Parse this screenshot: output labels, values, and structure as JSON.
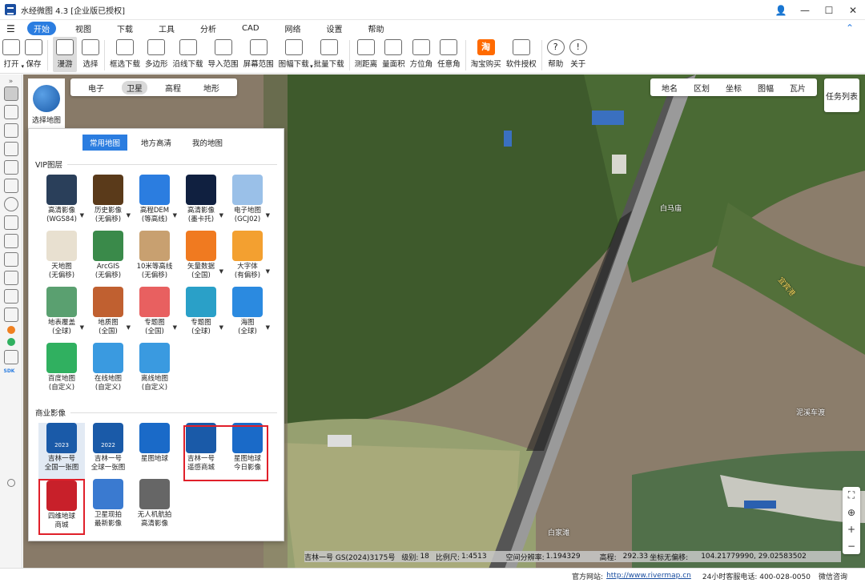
{
  "app": {
    "title": "水经微图 4.3 [企业版已授权]"
  },
  "window": {
    "user_icon": "user-icon",
    "minimize": "—",
    "maximize": "☐",
    "close": "✕"
  },
  "menu": {
    "items": [
      "开始",
      "视图",
      "下载",
      "工具",
      "分析",
      "CAD",
      "网络",
      "设置",
      "帮助"
    ],
    "active": "开始"
  },
  "toolbar": {
    "items": [
      {
        "label": "打开",
        "icon": "folder-icon",
        "dropdown": true
      },
      {
        "label": "保存",
        "icon": "save-icon"
      },
      {
        "label": "漫游",
        "icon": "hand-icon",
        "selected": true
      },
      {
        "label": "选择",
        "icon": "pointer-icon"
      },
      {
        "label": "框选下载",
        "icon": "box-select-download-icon"
      },
      {
        "label": "多边形",
        "icon": "polygon-icon"
      },
      {
        "label": "沿线下载",
        "icon": "line-download-icon"
      },
      {
        "label": "导入范围",
        "icon": "import-range-icon"
      },
      {
        "label": "屏幕范围",
        "icon": "screen-range-icon"
      },
      {
        "label": "图幅下载",
        "icon": "sheet-download-icon",
        "dropdown": true
      },
      {
        "label": "批量下载",
        "icon": "batch-download-icon"
      },
      {
        "label": "测距离",
        "icon": "ruler-icon"
      },
      {
        "label": "量面积",
        "icon": "area-icon"
      },
      {
        "label": "方位角",
        "icon": "azimuth-icon"
      },
      {
        "label": "任意角",
        "icon": "angle-icon"
      },
      {
        "label": "淘宝购买",
        "icon": "taobao-icon"
      },
      {
        "label": "软件授权",
        "icon": "license-icon"
      },
      {
        "label": "帮助",
        "icon": "help-icon"
      },
      {
        "label": "关于",
        "icon": "info-icon"
      }
    ]
  },
  "map": {
    "types": [
      "电子",
      "卫星",
      "高程",
      "地形"
    ],
    "active_type": "卫星",
    "layers": [
      "地名",
      "区划",
      "坐标",
      "图幅",
      "瓦片"
    ],
    "task_list": "任务列表",
    "chooser_label": "选择地图",
    "place_labels": [
      "白马庙",
      "泥溪车渡",
      "白家滩",
      "宜宾港"
    ]
  },
  "panel": {
    "tabs": [
      "常用地图",
      "地方高清",
      "我的地图"
    ],
    "active_tab": "常用地图",
    "vip_title": "VIP图层",
    "vip_items": [
      {
        "l1": "高清影像",
        "l2": "(WGS84)",
        "color": "#2a3f5a",
        "dd": true
      },
      {
        "l1": "历史影像",
        "l2": "(无偏移)",
        "color": "#5a3a1a",
        "dd": true
      },
      {
        "l1": "高程DEM",
        "l2": "(等高线)",
        "color": "#2b7de0",
        "dd": true
      },
      {
        "l1": "高清影像",
        "l2": "(墨卡托)",
        "color": "#102040",
        "dd": true
      },
      {
        "l1": "电子地图",
        "l2": "(GCJ02)",
        "color": "#9ac0e8",
        "dd": true
      },
      {
        "l1": "天地图",
        "l2": "(无偏移)",
        "color": "#e8e0d0",
        "dd": false
      },
      {
        "l1": "ArcGIS",
        "l2": "(无偏移)",
        "color": "#3a8a4a",
        "dd": false
      },
      {
        "l1": "10米等高线",
        "l2": "(无偏移)",
        "color": "#c8a070",
        "dd": false
      },
      {
        "l1": "矢量数据",
        "l2": "(全国)",
        "color": "#f07a20",
        "dd": true
      },
      {
        "l1": "大字体",
        "l2": "(有偏移)",
        "color": "#f3a030",
        "dd": true
      },
      {
        "l1": "地表覆盖",
        "l2": "(全球)",
        "color": "#5aa070",
        "dd": true
      },
      {
        "l1": "地质图",
        "l2": "(全国)",
        "color": "#c06030",
        "dd": true
      },
      {
        "l1": "专题图",
        "l2": "(全国)",
        "color": "#e86060",
        "dd": true
      },
      {
        "l1": "专题图",
        "l2": "(全球)",
        "color": "#2aa0c8",
        "dd": true
      },
      {
        "l1": "海图",
        "l2": "(全球)",
        "color": "#2b8ae0",
        "dd": true
      },
      {
        "l1": "百度地图",
        "l2": "(自定义)",
        "color": "#30b060",
        "dd": false
      },
      {
        "l1": "在线地图",
        "l2": "(自定义)",
        "color": "#3a9ae0",
        "dd": false
      },
      {
        "l1": "离线地图",
        "l2": "(自定义)",
        "color": "#3a9ae0",
        "dd": false
      }
    ],
    "commercial_title": "商业影像",
    "commercial_items": [
      {
        "l1": "吉林一号",
        "l2": "全国一张图",
        "color": "#1a5aa8",
        "badge": "2023",
        "selected": true
      },
      {
        "l1": "吉林一号",
        "l2": "全球一张图",
        "color": "#1a5aa8",
        "badge": "2022"
      },
      {
        "l1": "星图地球",
        "l2": "",
        "color": "#1a6ac8"
      },
      {
        "l1": "吉林一号",
        "l2": "遥感商城",
        "color": "#1a5aa8"
      },
      {
        "l1": "星图地球",
        "l2": "今日影像",
        "color": "#1a6ac8"
      },
      {
        "l1": "四维地球",
        "l2": "商城",
        "color": "#c8202a",
        "highlight": true
      },
      {
        "l1": "卫星现拍",
        "l2": "最新影像",
        "color": "#3a7ad0"
      },
      {
        "l1": "无人机航拍",
        "l2": "高清影像",
        "color": "#666666"
      }
    ]
  },
  "status": {
    "source": "吉林一号 GS(2024)3175号",
    "level_label": "级别:",
    "level": "18",
    "scale_label": "比例尺:",
    "scale": "1:4513",
    "res_label": "空间分辨率:",
    "res": "1.194329",
    "elev_label": "高程:",
    "elev": "292.33",
    "coord_label": "坐标无偏移:",
    "coord": "104.21779990, 29.02583502"
  },
  "footer": {
    "site_label": "官方网站:",
    "site_url": "http://www.rivermap.cn",
    "phone": "24小时客服电话: 400-028-0050",
    "wechat": "微信咨询"
  },
  "colors": {
    "accent": "#2b7de0",
    "highlight": "#e0202a"
  }
}
